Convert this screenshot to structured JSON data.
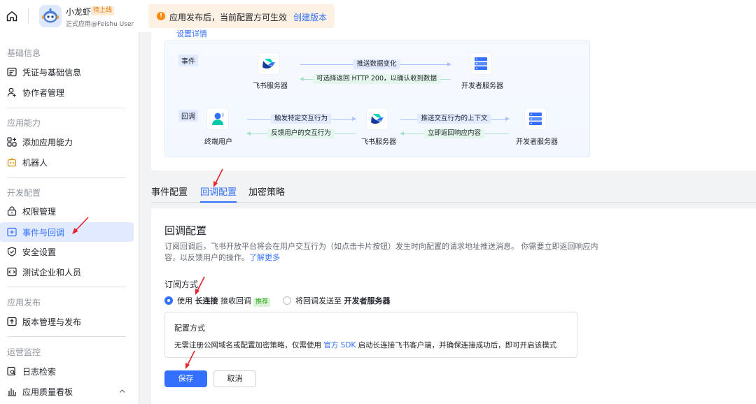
{
  "app": {
    "name": "小龙虾",
    "badge": "待上线",
    "owner": "正式应用@Feishu User"
  },
  "notice": {
    "text": "应用发布后，当前配置方可生效",
    "link": "创建版本"
  },
  "sidebar": {
    "sections": [
      {
        "title": "基础信息",
        "items": [
          {
            "label": "凭证与基础信息",
            "icon": "credential-icon"
          },
          {
            "label": "协作者管理",
            "icon": "user-icon"
          }
        ]
      },
      {
        "title": "应用能力",
        "items": [
          {
            "label": "添加应用能力",
            "icon": "apps-icon"
          },
          {
            "label": "机器人",
            "icon": "robot-icon"
          }
        ]
      },
      {
        "title": "开发配置",
        "items": [
          {
            "label": "权限管理",
            "icon": "lock-icon"
          },
          {
            "label": "事件与回调",
            "icon": "event-icon",
            "active": true
          },
          {
            "label": "安全设置",
            "icon": "shield-icon"
          },
          {
            "label": "测试企业和人员",
            "icon": "code-icon"
          }
        ]
      },
      {
        "title": "应用发布",
        "items": [
          {
            "label": "版本管理与发布",
            "icon": "upload-icon"
          }
        ]
      },
      {
        "title": "运营监控",
        "items": [
          {
            "label": "日志检索",
            "icon": "log-search-icon"
          },
          {
            "label": "应用质量看板",
            "icon": "chart-icon"
          }
        ]
      }
    ]
  },
  "diagram": {
    "cut_text": "设置详情",
    "event_row": {
      "tag": "事件",
      "feishu_server": "飞书服务器",
      "dev_server": "开发者服务器",
      "push_label": "推送数据变化",
      "return_label": "可选择返回 HTTP 200，以确认收到数据"
    },
    "callback_row": {
      "tag": "回调",
      "end_user": "终端用户",
      "feishu_server": "飞书服务器",
      "dev_server": "开发者服务器",
      "trigger_label": "触发特定交互行为",
      "feedback_label": "反馈用户的交互行为",
      "push_context_label": "推送交互行为的上下文",
      "respond_label": "立即返回响应内容"
    }
  },
  "tabs": [
    {
      "label": "事件配置"
    },
    {
      "label": "回调配置",
      "active": true
    },
    {
      "label": "加密策略"
    }
  ],
  "form": {
    "title": "回调配置",
    "desc": "订阅回调后，飞书开放平台将会在用户交互行为（如点击卡片按钮）发生时向配置的请求地址推送消息。 你需要立即返回响应内容，以反馈用户的操作。",
    "learn_more": "了解更多",
    "subscribe_label": "订阅方式",
    "option_long": {
      "pre": "使用 ",
      "bold": "长连接",
      "post": " 接收回调",
      "badge": "推荐"
    },
    "option_server": {
      "pre": "将回调发送至 ",
      "bold": "开发者服务器"
    },
    "method": {
      "title": "配置方式",
      "desc_pre": "无需注册公网域名或配置加密策略，仅需使用 ",
      "desc_link": "官方 SDK",
      "desc_post": " 启动长连接飞书客户端，并确保连接成功后，即可开启该模式"
    },
    "save": "保存",
    "cancel": "取消"
  },
  "colors": {
    "primary": "#3370ff",
    "warning": "#ff8800",
    "pointer": "#e3242b",
    "success_badge": "#2ea121"
  }
}
